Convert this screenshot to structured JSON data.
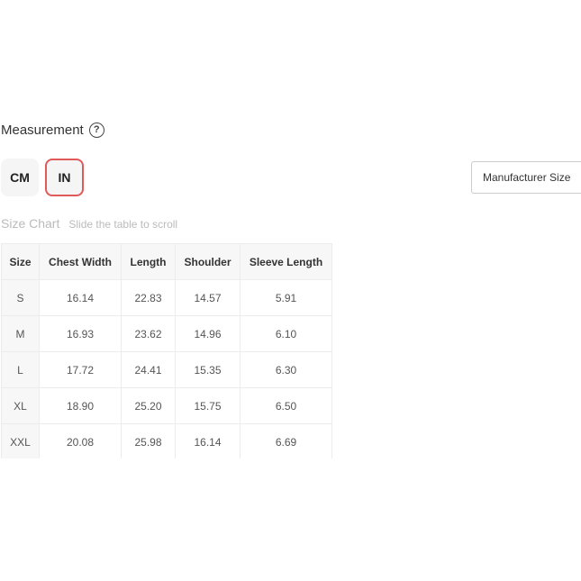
{
  "measurement": {
    "label": "Measurement",
    "help_glyph": "?"
  },
  "units": {
    "cm_label": "CM",
    "in_label": "IN",
    "selected": "IN"
  },
  "size_select": {
    "value": "Manufacturer Size"
  },
  "size_chart": {
    "title": "Size Chart",
    "hint": "Slide the table to scroll",
    "columns": [
      "Size",
      "Chest Width",
      "Length",
      "Shoulder",
      "Sleeve Length"
    ],
    "rows": [
      [
        "S",
        "16.14",
        "22.83",
        "14.57",
        "5.91"
      ],
      [
        "M",
        "16.93",
        "23.62",
        "14.96",
        "6.10"
      ],
      [
        "L",
        "17.72",
        "24.41",
        "15.35",
        "6.30"
      ],
      [
        "XL",
        "18.90",
        "25.20",
        "15.75",
        "6.50"
      ],
      [
        "XXL",
        "20.08",
        "25.98",
        "16.14",
        "6.69"
      ]
    ]
  },
  "colors": {
    "selected_border": "#e05a5a",
    "muted_text": "#bbbbbb"
  }
}
